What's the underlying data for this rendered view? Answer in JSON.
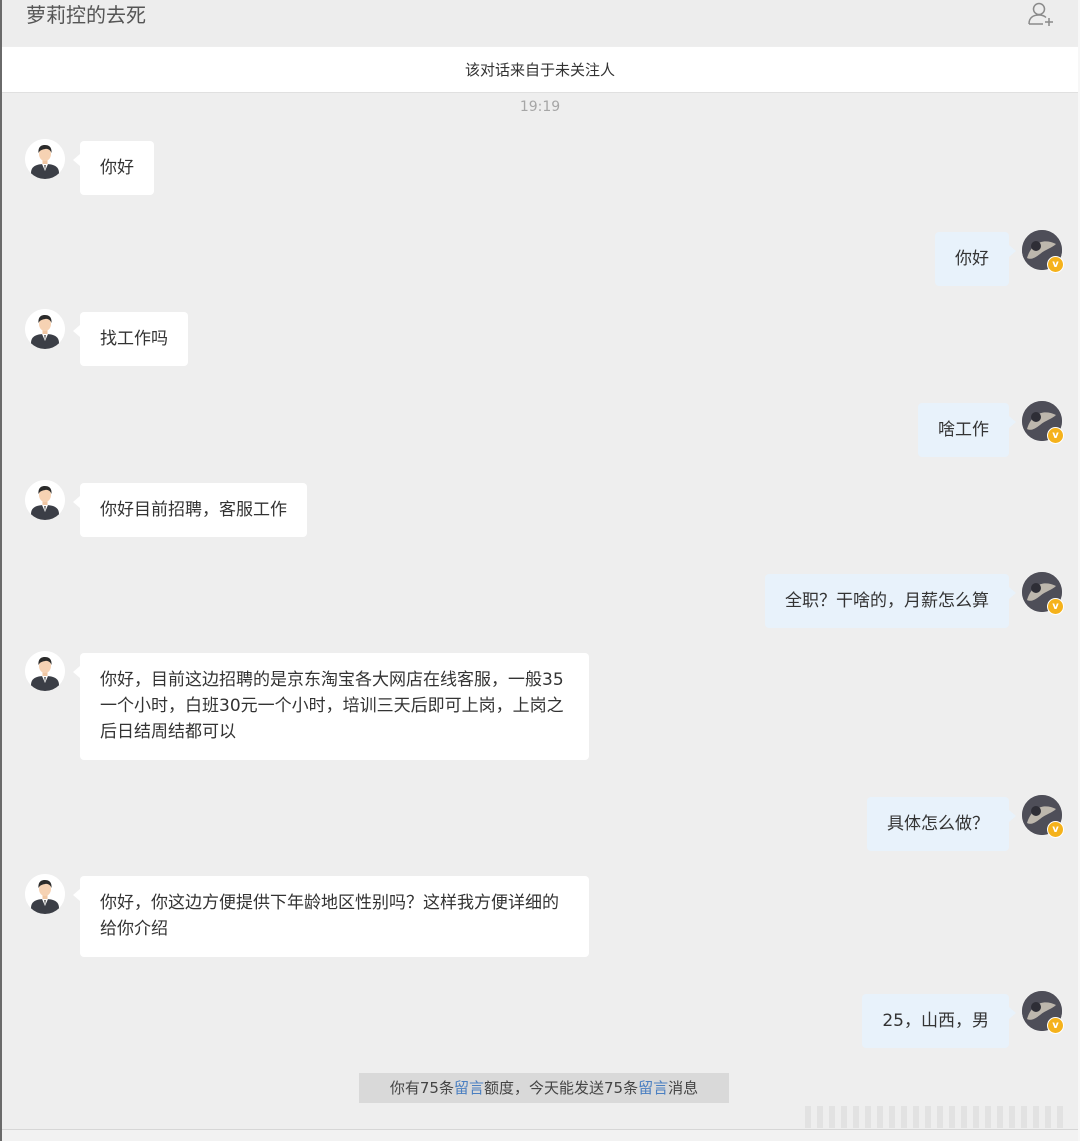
{
  "header": {
    "title": "萝莉控的去死",
    "add_contact_icon": "person-add-icon"
  },
  "notice": "该对话来自于未关注人",
  "timestamp": "19:19",
  "messages": [
    {
      "side": "left",
      "text": "你好"
    },
    {
      "side": "right",
      "text": "你好"
    },
    {
      "side": "left",
      "text": "找工作吗"
    },
    {
      "side": "right",
      "text": "啥工作"
    },
    {
      "side": "left",
      "text": "你好目前招聘，客服工作"
    },
    {
      "side": "right",
      "text": "全职？干啥的，月薪怎么算"
    },
    {
      "side": "left",
      "text": "你好，目前这边招聘的是京东淘宝各大网店在线客服，一般35一个小时，白班30元一个小时，培训三天后即可上岗，上岗之后日结周结都可以"
    },
    {
      "side": "right",
      "text": "具体怎么做？"
    },
    {
      "side": "left",
      "text": "你好，你这边方便提供下年龄地区性别吗？这样我方便详细的给你介绍"
    },
    {
      "side": "right",
      "text": "25，山西，男"
    }
  ],
  "quota": {
    "part1": "你有75条",
    "link1": "留言",
    "part2": "额度，今天能发送75条",
    "link2": "留言",
    "part3": "消息"
  },
  "badges": {
    "vip_symbol": "v",
    "vip_color": "#f5b21b"
  },
  "colors": {
    "background": "#eeeeee",
    "left_bubble": "#ffffff",
    "right_bubble": "#e8f2fb",
    "link": "#4a7fc1"
  }
}
